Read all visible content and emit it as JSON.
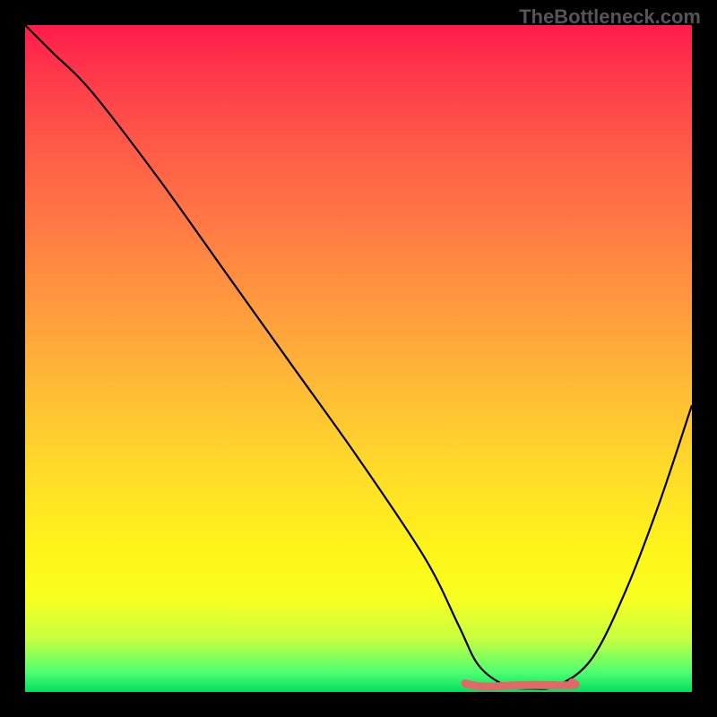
{
  "watermark": "TheBottleneck.com",
  "chart_data": {
    "type": "line",
    "title": "",
    "xlabel": "",
    "ylabel": "",
    "xlim": [
      0,
      100
    ],
    "ylim": [
      0,
      100
    ],
    "series": [
      {
        "name": "bottleneck-curve",
        "x": [
          0,
          4,
          10,
          20,
          30,
          40,
          50,
          60,
          65,
          68,
          72,
          76,
          80,
          85,
          90,
          95,
          100
        ],
        "y": [
          100,
          96,
          90,
          77,
          63,
          49,
          35,
          20,
          10,
          4,
          1,
          0.5,
          1,
          5,
          15,
          28,
          43
        ]
      }
    ],
    "annotations": [
      {
        "name": "minimum-highlight",
        "x_range": [
          66,
          82
        ],
        "y": 1,
        "color": "#e06868"
      }
    ],
    "background_gradient": {
      "top": "#ff1b4b",
      "mid": "#ffd92a",
      "bottom": "#00e060"
    }
  }
}
